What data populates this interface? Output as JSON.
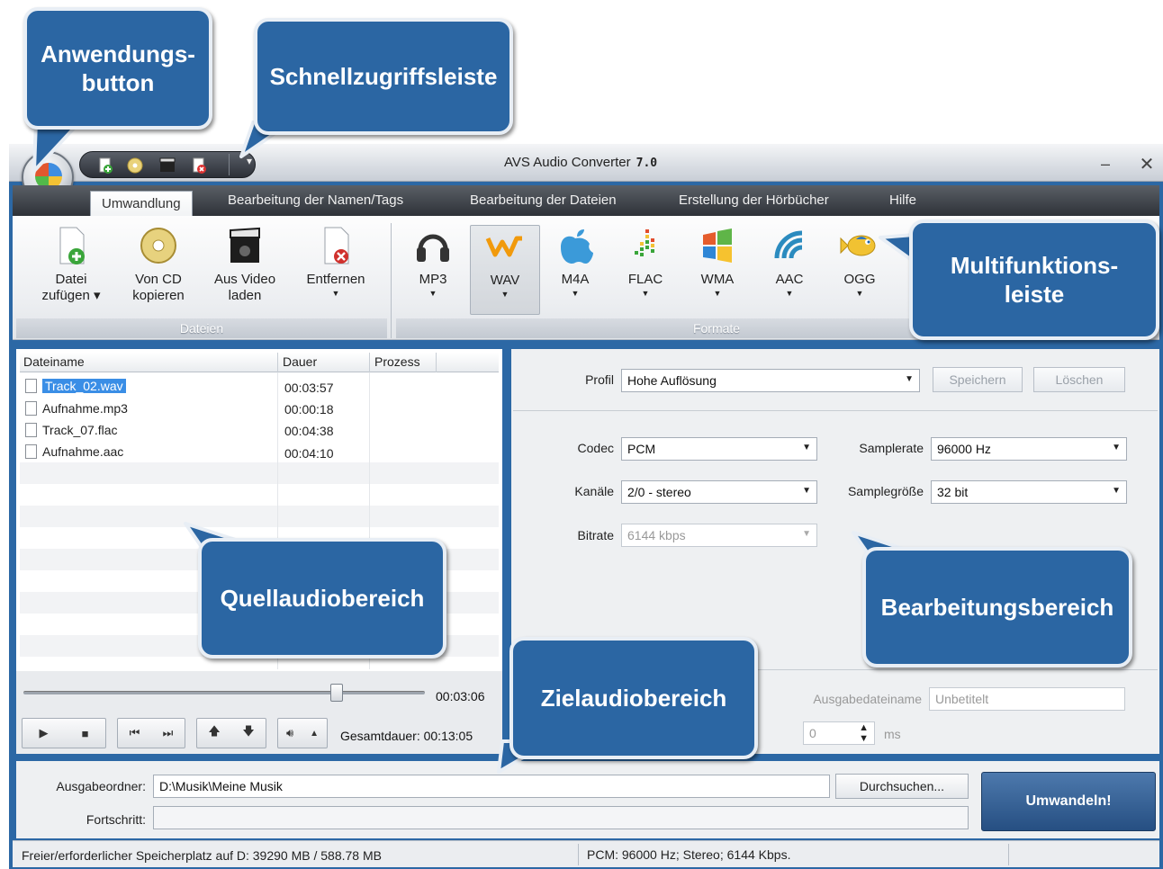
{
  "window": {
    "title": "AVS Audio Converter",
    "version": "7.0"
  },
  "quick_access": {
    "icons": [
      "add-file-icon",
      "cd-icon",
      "video-icon",
      "remove-icon"
    ],
    "more": "▾"
  },
  "ribbon": {
    "tabs": [
      "Umwandlung",
      "Bearbeitung der Namen/Tags",
      "Bearbeitung der Dateien",
      "Erstellung der Hörbücher",
      "Hilfe"
    ],
    "groups": {
      "files": "Dateien",
      "formats": "Formate"
    },
    "file_buttons": [
      {
        "label1": "Datei",
        "label2": "zufügen ▾"
      },
      {
        "label1": "Von CD",
        "label2": "kopieren"
      },
      {
        "label1": "Aus Video",
        "label2": "laden"
      },
      {
        "label1": "Entfernen",
        "label2": ""
      }
    ],
    "formats": [
      "MP3",
      "WAV",
      "M4A",
      "FLAC",
      "WMA",
      "AAC",
      "OGG"
    ],
    "selected_format": "WAV"
  },
  "file_list": {
    "columns": [
      "Dateiname",
      "Dauer",
      "Prozess"
    ],
    "rows": [
      {
        "name": "Track_02.wav",
        "duration": "00:03:57"
      },
      {
        "name": "Aufnahme.mp3",
        "duration": "00:00:18"
      },
      {
        "name": "Track_07.flac",
        "duration": "00:04:38"
      },
      {
        "name": "Aufnahme.aac",
        "duration": "00:04:10"
      }
    ]
  },
  "player": {
    "current_time": "00:03:06",
    "position_fraction": 0.78,
    "total_label": "Gesamtdauer:",
    "total": "00:13:05"
  },
  "settings": {
    "profile_label": "Profil",
    "profile_value": "Hohe Auflösung",
    "save": "Speichern",
    "delete": "Löschen",
    "codec_label": "Codec",
    "codec_value": "PCM",
    "samplerate_label": "Samplerate",
    "samplerate_value": "96000 Hz",
    "channels_label": "Kanäle",
    "channels_value": "2/0 - stereo",
    "samplesize_label": "Samplegröße",
    "samplesize_value": "32 bit",
    "bitrate_label": "Bitrate",
    "bitrate_value": "6144 kbps",
    "output_name_label": "Ausgabedateiname",
    "output_name_value": "Unbetitelt",
    "pause_value": "0",
    "pause_unit": "ms"
  },
  "bottom": {
    "output_folder_label": "Ausgabeordner:",
    "output_folder_value": "D:\\Musik\\Meine Musik",
    "browse": "Durchsuchen...",
    "progress_label": "Fortschritt:",
    "convert": "Umwandeln!"
  },
  "status": {
    "disk": "Freier/erforderlicher Speicherplatz auf D: 39290 MB / 588.78 MB",
    "format": "PCM: 96000  Hz; Stereo; 6144 Kbps."
  },
  "callouts": {
    "app_button": "Anwendungs-\nbutton",
    "quick_access": "Schnellzugriffsleiste",
    "ribbon": "Multifunktions-\nleiste",
    "source": "Quellaudiobereich",
    "edit": "Bearbeitungsbereich",
    "target": "Zielaudiobereich"
  },
  "colors": {
    "accent": "#2b66a3",
    "frame": "#2c68a5",
    "selection": "#3a8ee6"
  }
}
